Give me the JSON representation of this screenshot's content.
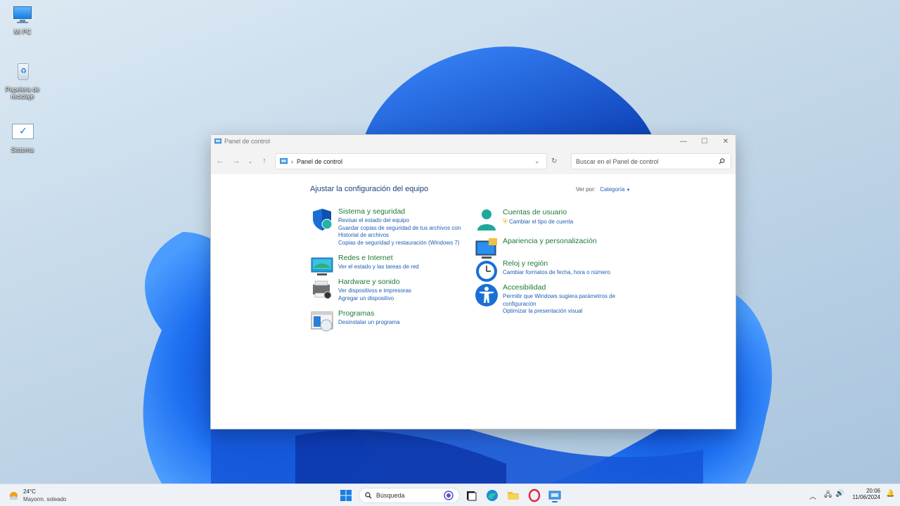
{
  "desktop": {
    "icons": [
      {
        "label": "Mi PC"
      },
      {
        "label": "Papelera de reciclaje"
      },
      {
        "label": "Sistema"
      }
    ]
  },
  "window": {
    "title": "Panel de control",
    "address": {
      "crumb": "Panel de control"
    },
    "search": {
      "placeholder": "Buscar en el Panel de control"
    },
    "heading": "Ajustar la configuración del equipo",
    "view_by": {
      "label": "Ver por:",
      "value": "Categoría"
    },
    "categories_left": [
      {
        "title": "Sistema y seguridad",
        "links": [
          "Revisar el estado del equipo",
          "Guardar copias de seguridad de tus archivos con Historial de archivos",
          "Copias de seguridad y restauración (Windows 7)"
        ]
      },
      {
        "title": "Redes e Internet",
        "links": [
          "Ver el estado y las tareas de red"
        ]
      },
      {
        "title": "Hardware y sonido",
        "links": [
          "Ver dispositivos e impresoras",
          "Agregar un dispositivo"
        ]
      },
      {
        "title": "Programas",
        "links": [
          "Desinstalar un programa"
        ]
      }
    ],
    "categories_right": [
      {
        "title": "Cuentas de usuario",
        "links": [
          "Cambiar el tipo de cuenta"
        ]
      },
      {
        "title": "Apariencia y personalización",
        "links": []
      },
      {
        "title": "Reloj y región",
        "links": [
          "Cambiar formatos de fecha, hora o número"
        ]
      },
      {
        "title": "Accesibilidad",
        "links": [
          "Permitir que Windows sugiera parámetros de configuración",
          "Optimizar la presentación visual"
        ]
      }
    ]
  },
  "taskbar": {
    "weather": {
      "temp": "24°C",
      "desc": "Mayorm. soleado"
    },
    "search_label": "Búsqueda",
    "clock": {
      "time": "20:06",
      "date": "11/06/2024"
    }
  },
  "colors": {
    "accent": "#1d5fb4",
    "category_title": "#1e7a35",
    "heading": "#1e3f7a"
  }
}
